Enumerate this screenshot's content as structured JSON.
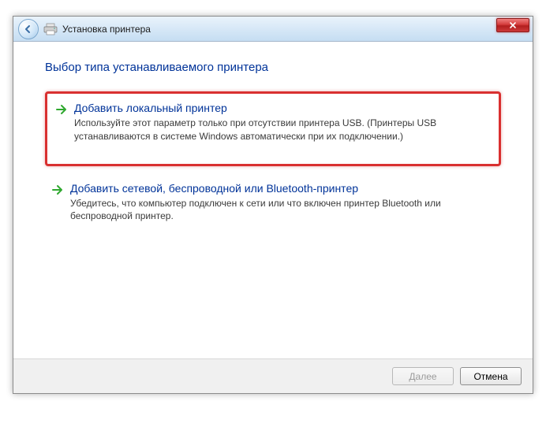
{
  "titlebar": {
    "title": "Установка принтера"
  },
  "page": {
    "heading": "Выбор типа устанавливаемого принтера"
  },
  "options": [
    {
      "title": "Добавить локальный принтер",
      "desc": "Используйте этот параметр только при отсутствии принтера USB. (Принтеры USB устанавливаются в системе Windows автоматически при их подключении.)"
    },
    {
      "title": "Добавить сетевой, беспроводной или Bluetooth-принтер",
      "desc": "Убедитесь, что компьютер подключен к сети или что включен принтер Bluetooth или беспроводной принтер."
    }
  ],
  "footer": {
    "next": "Далее",
    "cancel": "Отмена"
  },
  "colors": {
    "link": "#003399",
    "highlight": "#d93030"
  }
}
